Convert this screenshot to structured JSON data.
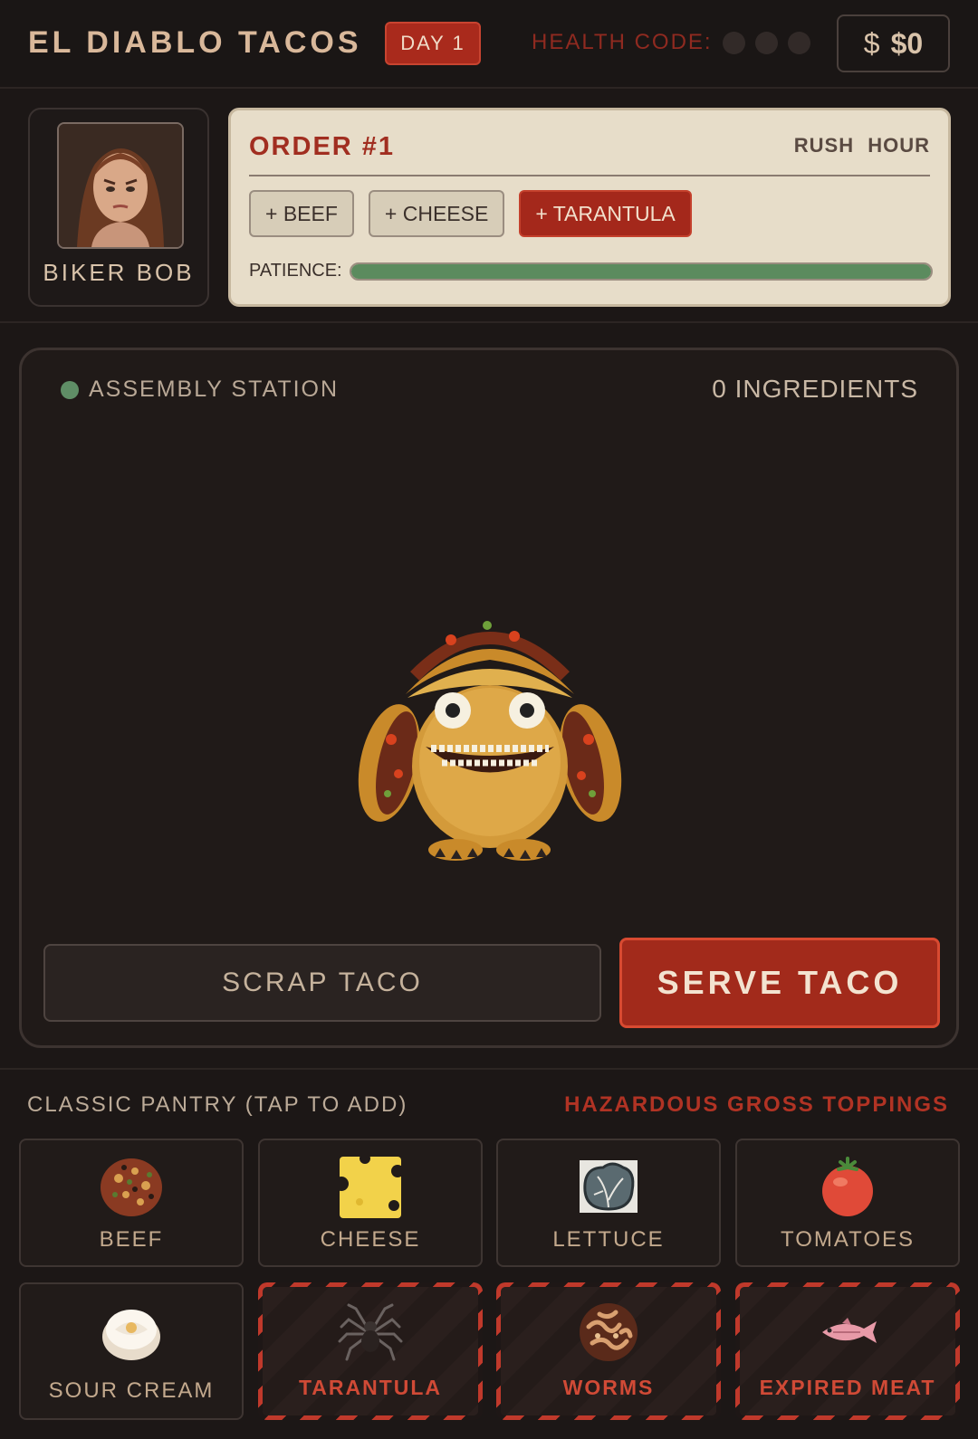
{
  "header": {
    "title": "EL DIABLO TACOS",
    "day": "DAY 1",
    "health_label": "HEALTH CODE:",
    "health_strikes": 0,
    "health_max": 3,
    "currency": "$",
    "money": "$0"
  },
  "customer": {
    "name": "BIKER BOB",
    "portrait_icon": "angry-customer-portrait"
  },
  "order": {
    "title": "ORDER #1",
    "mode": "RUSH  HOUR",
    "items": [
      "+ BEEF",
      "+ CHEESE",
      "+ TARANTULA"
    ],
    "patience_label": "PATIENCE:",
    "patience": 1.0
  },
  "assembly": {
    "station_label": "ASSEMBLY STATION",
    "ingredient_count": "0 INGREDIENTS",
    "mascot_icon": "taco-monster-icon",
    "scrap_label": "SCRAP TACO",
    "serve_label": "SERVE TACO"
  },
  "pantry": {
    "classic_label": "CLASSIC PANTRY (TAP TO ADD)",
    "gross_label": "HAZARDOUS GROSS TOPPINGS",
    "classic": [
      {
        "label": "BEEF",
        "icon": "beef-icon"
      },
      {
        "label": "CHEESE",
        "icon": "cheese-icon"
      },
      {
        "label": "LETTUCE",
        "icon": "lettuce-icon"
      },
      {
        "label": "TOMATOES",
        "icon": "tomato-icon"
      },
      {
        "label": "SOUR CREAM",
        "icon": "sour-cream-icon"
      }
    ],
    "gross": [
      {
        "label": "TARANTULA",
        "icon": "tarantula-icon"
      },
      {
        "label": "WORMS",
        "icon": "worms-icon"
      },
      {
        "label": "EXPIRED MEAT",
        "icon": "fish-icon"
      }
    ]
  },
  "colors": {
    "accent_red": "#a22a1b",
    "patience_green": "#5b8b5e",
    "background": "#1c1716",
    "order_card": "#e7ddc9"
  }
}
